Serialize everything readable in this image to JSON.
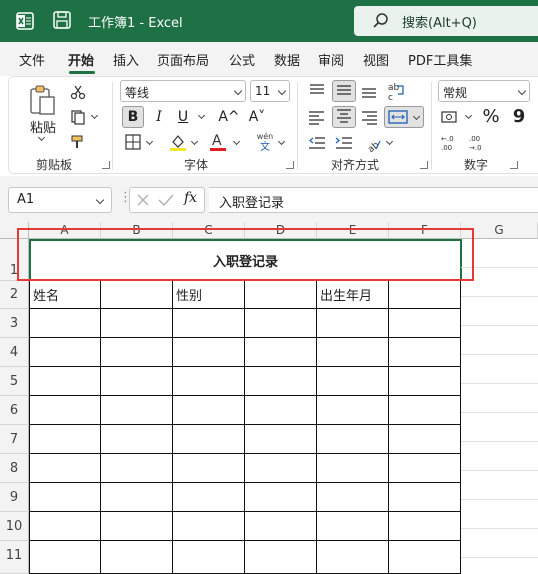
{
  "titlebar": {
    "title": "工作簿1  -  Excel",
    "search": "搜索(Alt+Q)",
    "bg_color": "#1e7145"
  },
  "tabs": [
    "文件",
    "开始",
    "插入",
    "页面布局",
    "公式",
    "数据",
    "审阅",
    "视图",
    "PDF工具集"
  ],
  "active_tab": "开始",
  "ribbon": {
    "clipboard": {
      "label": "剪贴板",
      "paste_label": "粘贴"
    },
    "font": {
      "label": "字体",
      "name": "等线",
      "size": "11",
      "bold": "B",
      "italic": "I",
      "underline": "U",
      "grow": "A^",
      "shrink": "A˅",
      "phonetic_top": "wén",
      "phonetic_bottom": "文"
    },
    "alignment": {
      "label": "对齐方式"
    },
    "number": {
      "label": "数字",
      "format": "常规",
      "percent": "%",
      "comma": "9"
    }
  },
  "formula_bar": {
    "name_box": "A1",
    "fx": "fx",
    "content": "入职登记录"
  },
  "columns": [
    "A",
    "B",
    "C",
    "D",
    "E",
    "F",
    "G"
  ],
  "rows": [
    "1",
    "2",
    "3",
    "4",
    "5",
    "6",
    "7",
    "8",
    "9",
    "10",
    "11"
  ],
  "merged_title": "入职登记录",
  "row2": [
    "姓名",
    "",
    "性别",
    "",
    "出生年月",
    ""
  ],
  "highlight_color": "#e53935"
}
